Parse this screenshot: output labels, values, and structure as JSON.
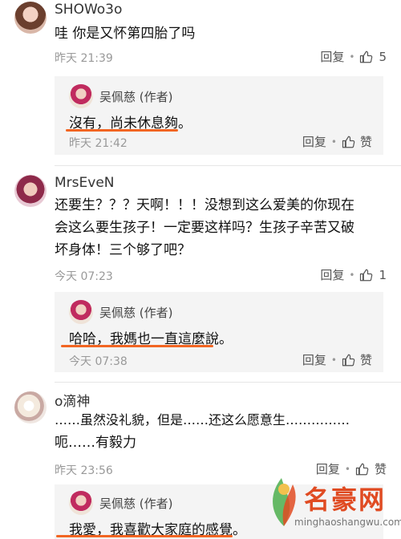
{
  "comments": [
    {
      "username": "SHOWo3o",
      "content": "哇 你是又怀第四胎了吗",
      "time": "昨天 21:39",
      "reply_label": "回复",
      "like_count": "5",
      "author_reply": {
        "name": "吴佩慈 (作者)",
        "text": "沒有，尚未休息夠。",
        "time": "昨天 21:42",
        "reply_label": "回复",
        "like_label": "赞"
      }
    },
    {
      "username": "MrsEveN",
      "content_lines": [
        "还要生？？？天啊！！！没想到这么爱美的你现在",
        "会这么要生孩子！一定要这样吗？生孩子辛苦又破",
        "坏身体！三个够了吧？"
      ],
      "time": "今天 07:23",
      "reply_label": "回复",
      "like_count": "1",
      "author_reply": {
        "name": "吴佩慈 (作者)",
        "text": "哈哈，我媽也一直這麼說。",
        "time": "今天 07:38",
        "reply_label": "回复",
        "like_label": "赞"
      }
    },
    {
      "username": "o滴神",
      "content_lines": [
        "……虽然没礼貌，但是……还这么愿意生……………",
        "呃……有毅力"
      ],
      "time": "昨天 23:56",
      "reply_label": "回复",
      "like_label": "赞",
      "author_reply": {
        "name": "吴佩慈 (作者)",
        "text": "我愛，我喜歡大家庭的感覺。"
      }
    }
  ],
  "watermark": {
    "text": "名豪网",
    "url": "minghaoshangwu.com"
  },
  "colors": {
    "underline": "#f26522",
    "reply_bg": "#f4f4f4",
    "watermark": "#e04b22"
  }
}
